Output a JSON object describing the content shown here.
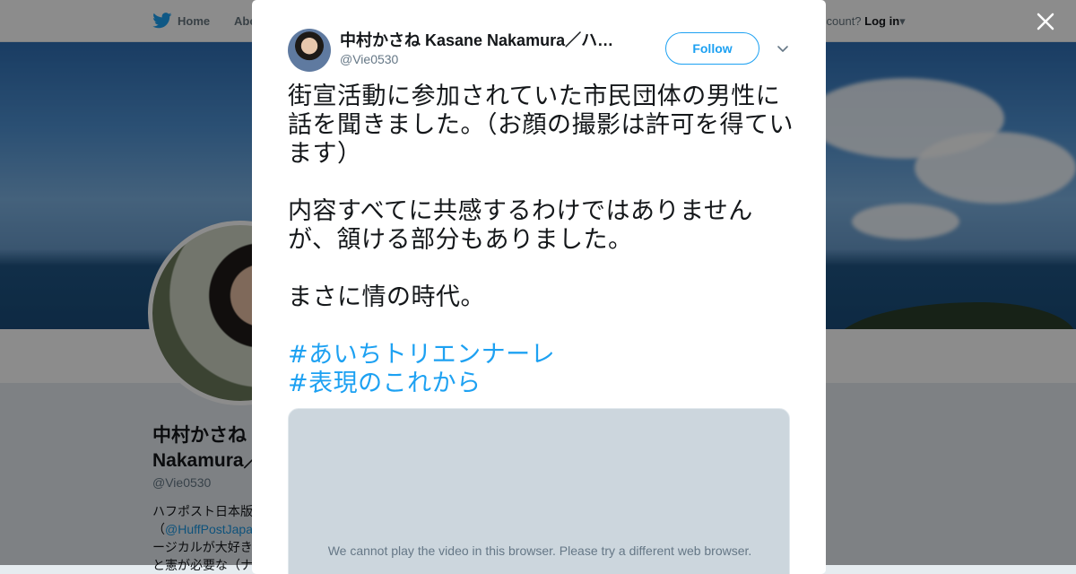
{
  "nav": {
    "home_label": "Home",
    "about_label": "Abo",
    "account_prompt": "ccount?",
    "login_label": "Log in"
  },
  "profile": {
    "name_line1": "中村かさね",
    "name_line2": "Nakamura／",
    "handle": "@Vie0530",
    "bio_line1": "ハフポスト日本版",
    "bio_line2_prefix": "（",
    "bio_link": "@HuffPostJapa",
    "bio_line3": "ージカルが大好き",
    "bio_line4": "と憲が必要な（ナ"
  },
  "tweet": {
    "author_name": "中村かさね Kasane Nakamura／ハ…",
    "author_handle": "@Vie0530",
    "follow_label": "Follow",
    "text_lines": [
      "街宣活動に参加されていた市民団体の男性に話を聞きました。（お顔の撮影は許可を得ています）",
      "内容すべてに共感するわけではありませんが、頷ける部分もありました。",
      "まさに情の時代。"
    ],
    "hashtags": [
      "#あいちトリエンナーレ",
      "#表現のこれから"
    ],
    "video_message": "We cannot play the video in this browser. Please try a different web browser."
  },
  "icons": {
    "bird": "twitter-bird-icon",
    "close": "close-icon",
    "caret": "chevron-down-icon"
  },
  "colors": {
    "accent": "#1da1f2",
    "text": "#14171a",
    "secondary": "#657786",
    "video_bg": "#ccd6dd"
  }
}
